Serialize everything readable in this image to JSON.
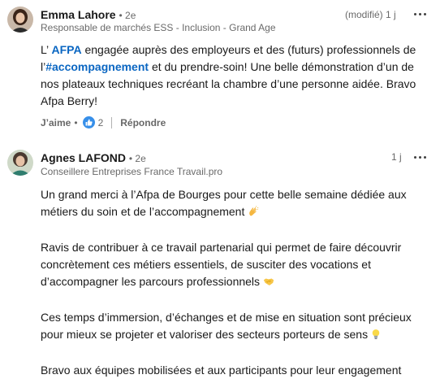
{
  "comments": [
    {
      "author": "Emma Lahore",
      "degree": "• 2e",
      "headline": "Responsable de marchés ESS - Inclusion - Grand Age",
      "edited": "(modifié)",
      "time": "1 j",
      "text": {
        "pre": "L’ ",
        "mention": "AFPA",
        "mid1": " engagée auprès des employeurs et des (futurs) professionnels de l’",
        "hashtag": "#accompagnement",
        "rest": " et du prendre-soin! Une belle démonstration d’un de nos plateaux techniques recréant la chambre d’une personne aidée. Bravo Afpa Berry!"
      },
      "like_label": "J’aime",
      "dot": "•",
      "reaction_count": "2",
      "reply_label": "Répondre"
    },
    {
      "author": "Agnes LAFOND",
      "degree": "• 2e",
      "headline": "Conseillere Entreprises France Travail.pro",
      "time": "1 j",
      "paragraphs": [
        "Un grand merci à l’Afpa de Bourges pour cette belle semaine dédiée aux métiers du soin et de l’accompagnement",
        "Ravis de contribuer à ce travail partenarial qui permet de faire découvrir concrètement ces métiers essentiels, de susciter des vocations et d’accompagner les parcours professionnels",
        "Ces temps d’immersion, d’échanges et de mise en situation sont précieux pour mieux se projeter et valoriser des secteurs porteurs de sens",
        "Bravo aux équipes mobilisées et aux participants pour leur engagement"
      ],
      "emojis": [
        "clapping-hands",
        "handshake",
        "light-bulb"
      ]
    }
  ],
  "colors": {
    "link": "#0a66c2",
    "like_badge": "#378fe9",
    "secondary_text": "rgba(0,0,0,0.6)"
  }
}
